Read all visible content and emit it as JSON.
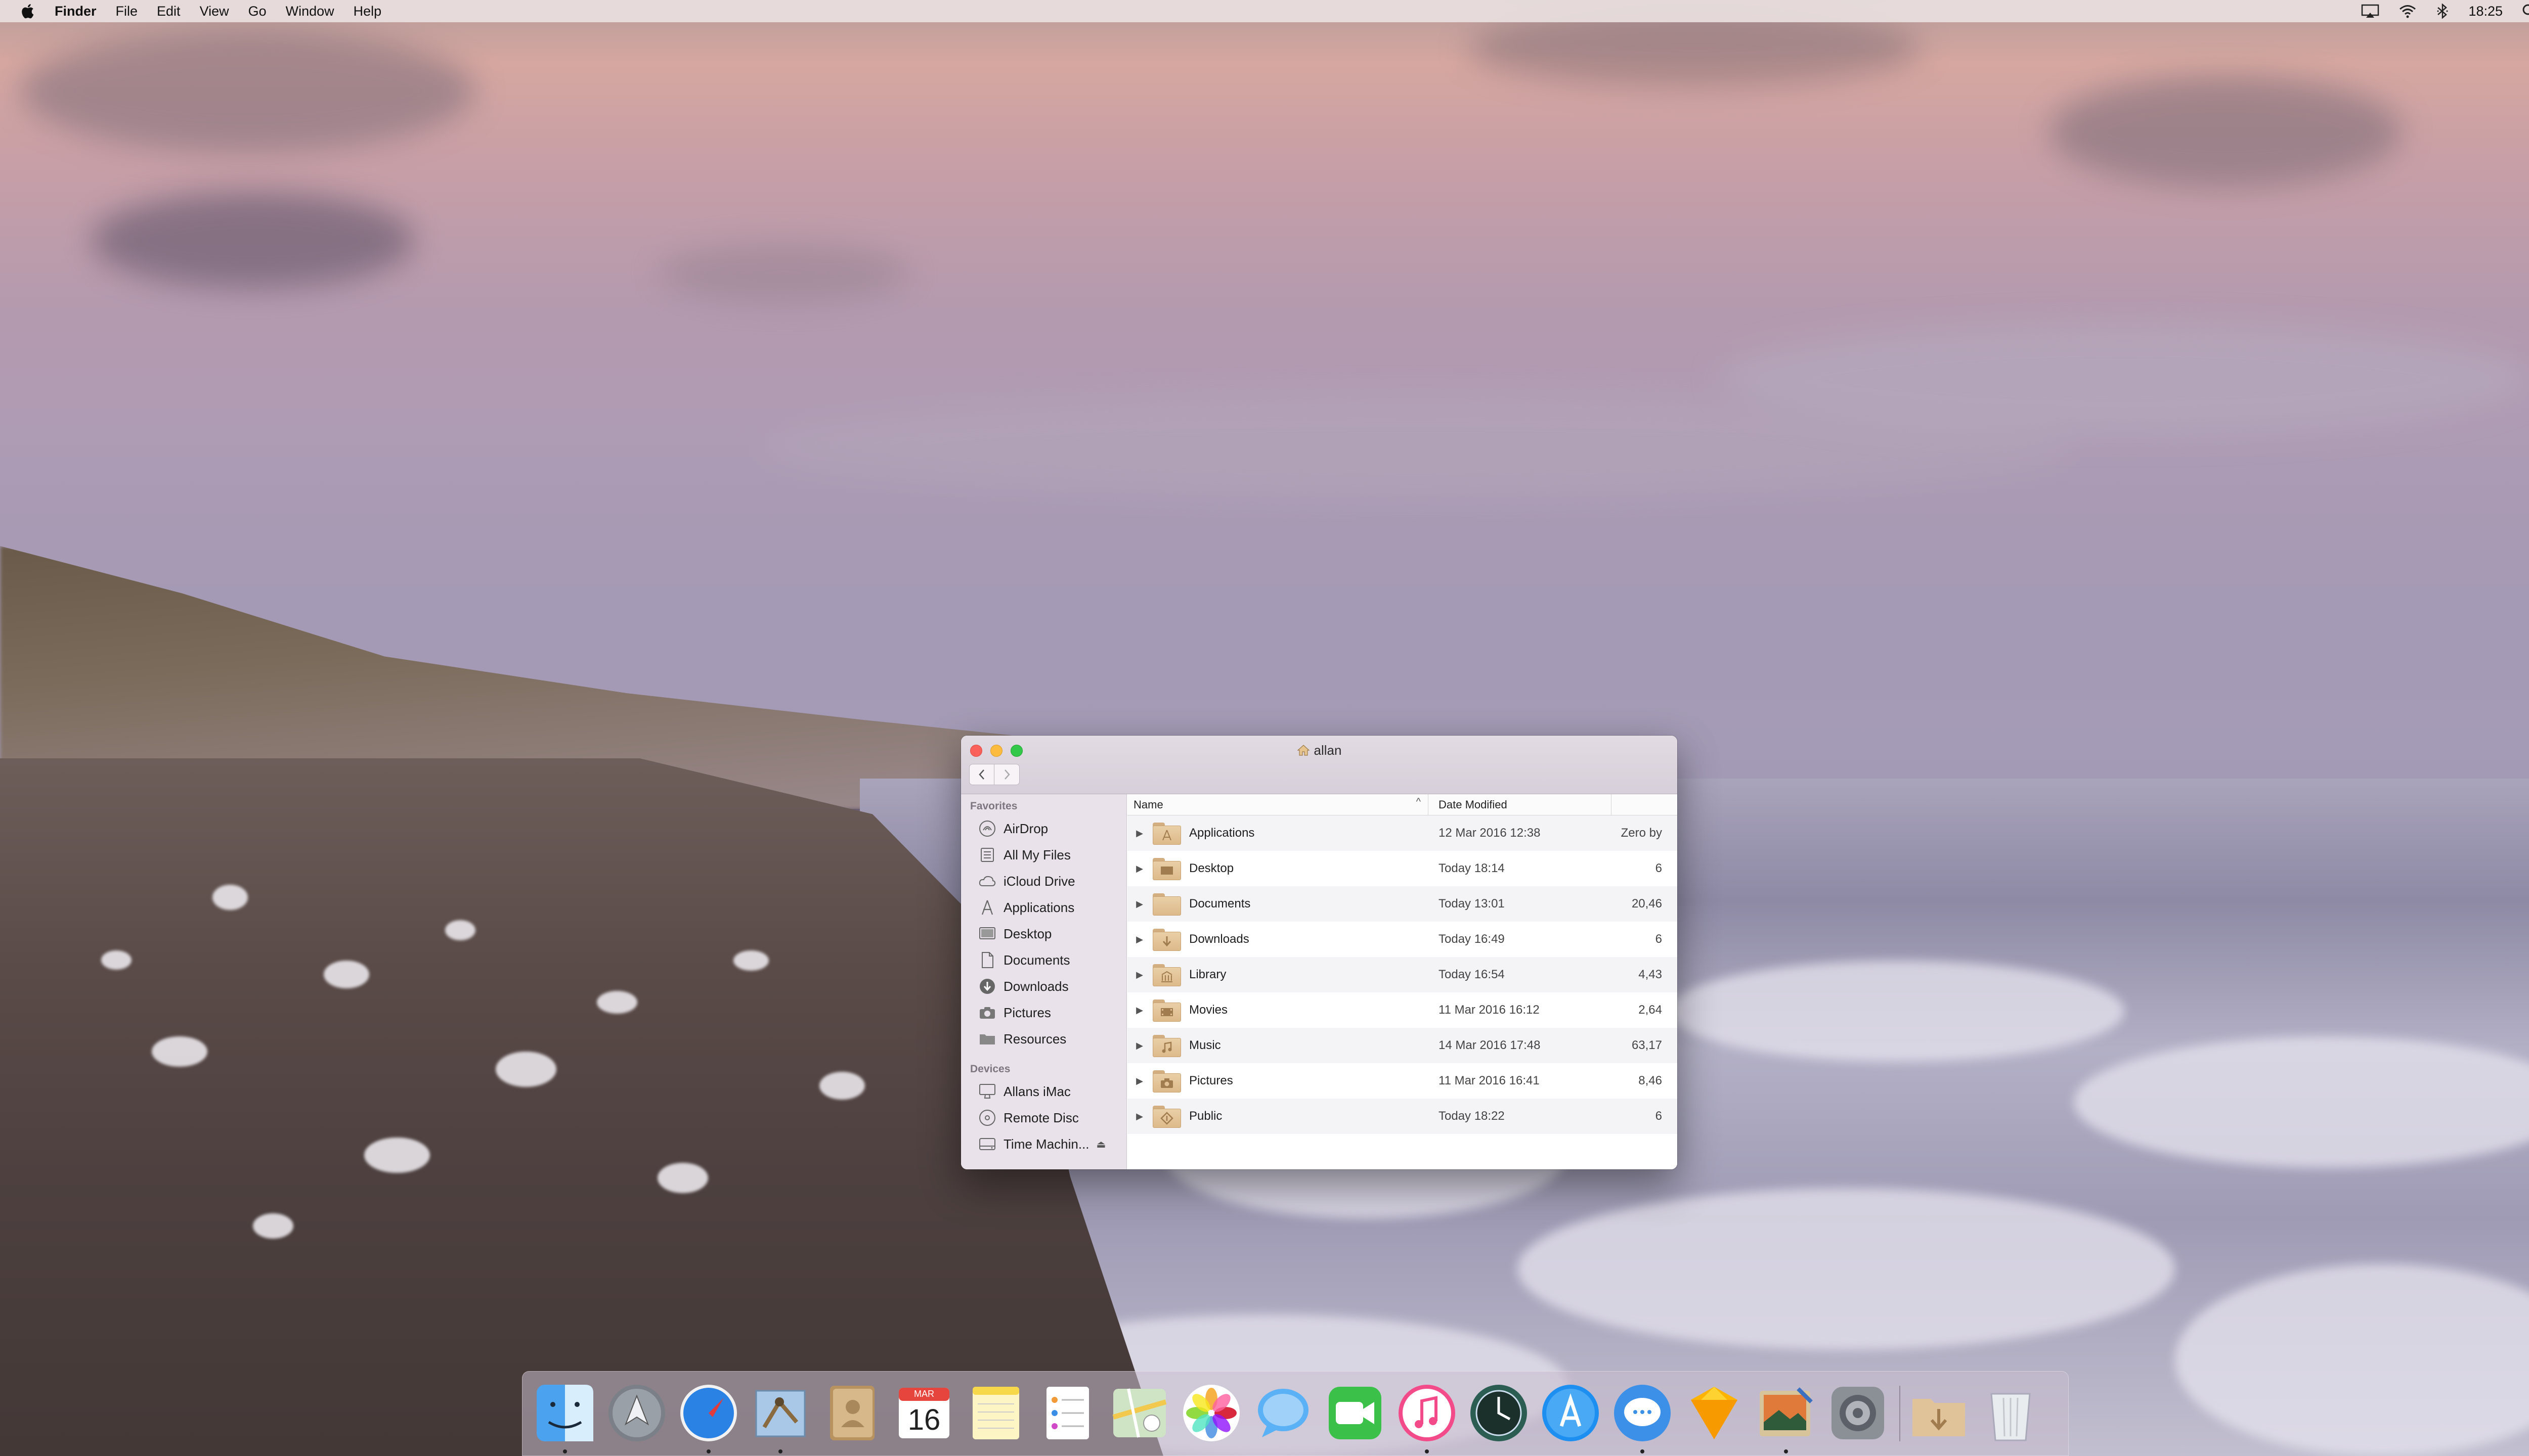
{
  "menubar": {
    "app_name": "Finder",
    "menus": [
      "File",
      "Edit",
      "View",
      "Go",
      "Window",
      "Help"
    ],
    "clock": "18:25",
    "status_icons": [
      "airplay-icon",
      "wifi-icon",
      "bluetooth-icon",
      "spotlight-icon",
      "notification-center-icon"
    ]
  },
  "window": {
    "title": "allan",
    "sidebar": {
      "favorites_heading": "Favorites",
      "favorites": [
        {
          "label": "AirDrop",
          "icon": "airdrop-icon"
        },
        {
          "label": "All My Files",
          "icon": "all-files-icon"
        },
        {
          "label": "iCloud Drive",
          "icon": "cloud-icon"
        },
        {
          "label": "Applications",
          "icon": "applications-icon"
        },
        {
          "label": "Desktop",
          "icon": "desktop-icon"
        },
        {
          "label": "Documents",
          "icon": "document-icon"
        },
        {
          "label": "Downloads",
          "icon": "downloads-icon"
        },
        {
          "label": "Pictures",
          "icon": "camera-icon"
        },
        {
          "label": "Resources",
          "icon": "folder-icon"
        }
      ],
      "devices_heading": "Devices",
      "devices": [
        {
          "label": "Allans iMac",
          "icon": "imac-icon"
        },
        {
          "label": "Remote Disc",
          "icon": "disc-icon"
        },
        {
          "label": "Time Machin...",
          "icon": "drive-icon",
          "eject": "⏏"
        }
      ]
    },
    "columns": {
      "name": "Name",
      "date": "Date Modified",
      "size": ""
    },
    "rows": [
      {
        "name": "Applications",
        "date": "12 Mar 2016 12:38",
        "size": "Zero by",
        "icon": "applications-folder-icon"
      },
      {
        "name": "Desktop",
        "date": "Today 18:14",
        "size": "6",
        "icon": "desktop-folder-icon"
      },
      {
        "name": "Documents",
        "date": "Today 13:01",
        "size": "20,46",
        "icon": "documents-folder-icon"
      },
      {
        "name": "Downloads",
        "date": "Today 16:49",
        "size": "6",
        "icon": "downloads-folder-icon"
      },
      {
        "name": "Library",
        "date": "Today 16:54",
        "size": "4,43",
        "icon": "library-folder-icon"
      },
      {
        "name": "Movies",
        "date": "11 Mar 2016 16:12",
        "size": "2,64",
        "icon": "movies-folder-icon"
      },
      {
        "name": "Music",
        "date": "14 Mar 2016 17:48",
        "size": "63,17",
        "icon": "music-folder-icon"
      },
      {
        "name": "Pictures",
        "date": "11 Mar 2016 16:41",
        "size": "8,46",
        "icon": "pictures-folder-icon"
      },
      {
        "name": "Public",
        "date": "Today 18:22",
        "size": "6",
        "icon": "public-folder-icon"
      }
    ]
  },
  "dock": {
    "apps": [
      {
        "name": "finder-icon",
        "running": true
      },
      {
        "name": "launchpad-icon",
        "running": false
      },
      {
        "name": "safari-icon",
        "running": true
      },
      {
        "name": "mail-icon",
        "running": true
      },
      {
        "name": "contacts-icon",
        "running": false
      },
      {
        "name": "calendar-icon",
        "running": false,
        "month": "MAR",
        "day": "16"
      },
      {
        "name": "notes-icon",
        "running": false
      },
      {
        "name": "reminders-icon",
        "running": false
      },
      {
        "name": "maps-icon",
        "running": false
      },
      {
        "name": "photos-icon",
        "running": false
      },
      {
        "name": "messages-icon",
        "running": false
      },
      {
        "name": "facetime-icon",
        "running": false
      },
      {
        "name": "itunes-icon",
        "running": true
      },
      {
        "name": "time-machine-icon",
        "running": false
      },
      {
        "name": "app-store-icon",
        "running": false
      },
      {
        "name": "chat-icon",
        "running": true
      },
      {
        "name": "sketch-icon",
        "running": false
      },
      {
        "name": "preview-icon",
        "running": true
      },
      {
        "name": "system-preferences-icon",
        "running": false
      },
      {
        "name": "downloads-stack-icon",
        "running": false
      },
      {
        "name": "trash-icon",
        "running": false
      }
    ]
  },
  "colors": {
    "close": "#fc605b",
    "minimize": "#fdbc40",
    "maximize": "#34c84a",
    "folder": "#e3c197"
  }
}
